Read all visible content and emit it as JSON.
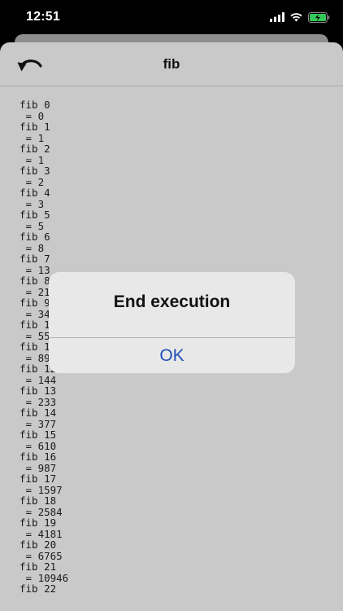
{
  "status_bar": {
    "time": "12:51",
    "icons": [
      "signal-icon",
      "wifi-icon",
      "battery-charging-icon"
    ],
    "battery_color": "#34c759"
  },
  "nav": {
    "title": "fib",
    "back_icon": "undo-arrow-icon"
  },
  "output_lines": [
    "fib 0",
    " = 0",
    "fib 1",
    " = 1",
    "fib 2",
    " = 1",
    "fib 3",
    " = 2",
    "fib 4",
    " = 3",
    "fib 5",
    " = 5",
    "fib 6",
    " = 8",
    "fib 7",
    " = 13",
    "fib 8",
    " = 21",
    "fib 9",
    " = 34",
    "fib 10",
    " = 55",
    "fib 11",
    " = 89",
    "fib 12",
    " = 144",
    "fib 13",
    " = 233",
    "fib 14",
    " = 377",
    "fib 15",
    " = 610",
    "fib 16",
    " = 987",
    "fib 17",
    " = 1597",
    "fib 18",
    " = 2584",
    "fib 19",
    " = 4181",
    "fib 20",
    " = 6765",
    "fib 21",
    " = 10946",
    "fib 22"
  ],
  "alert": {
    "title": "End execution",
    "ok_label": "OK",
    "ok_color": "#1f4fb8"
  }
}
